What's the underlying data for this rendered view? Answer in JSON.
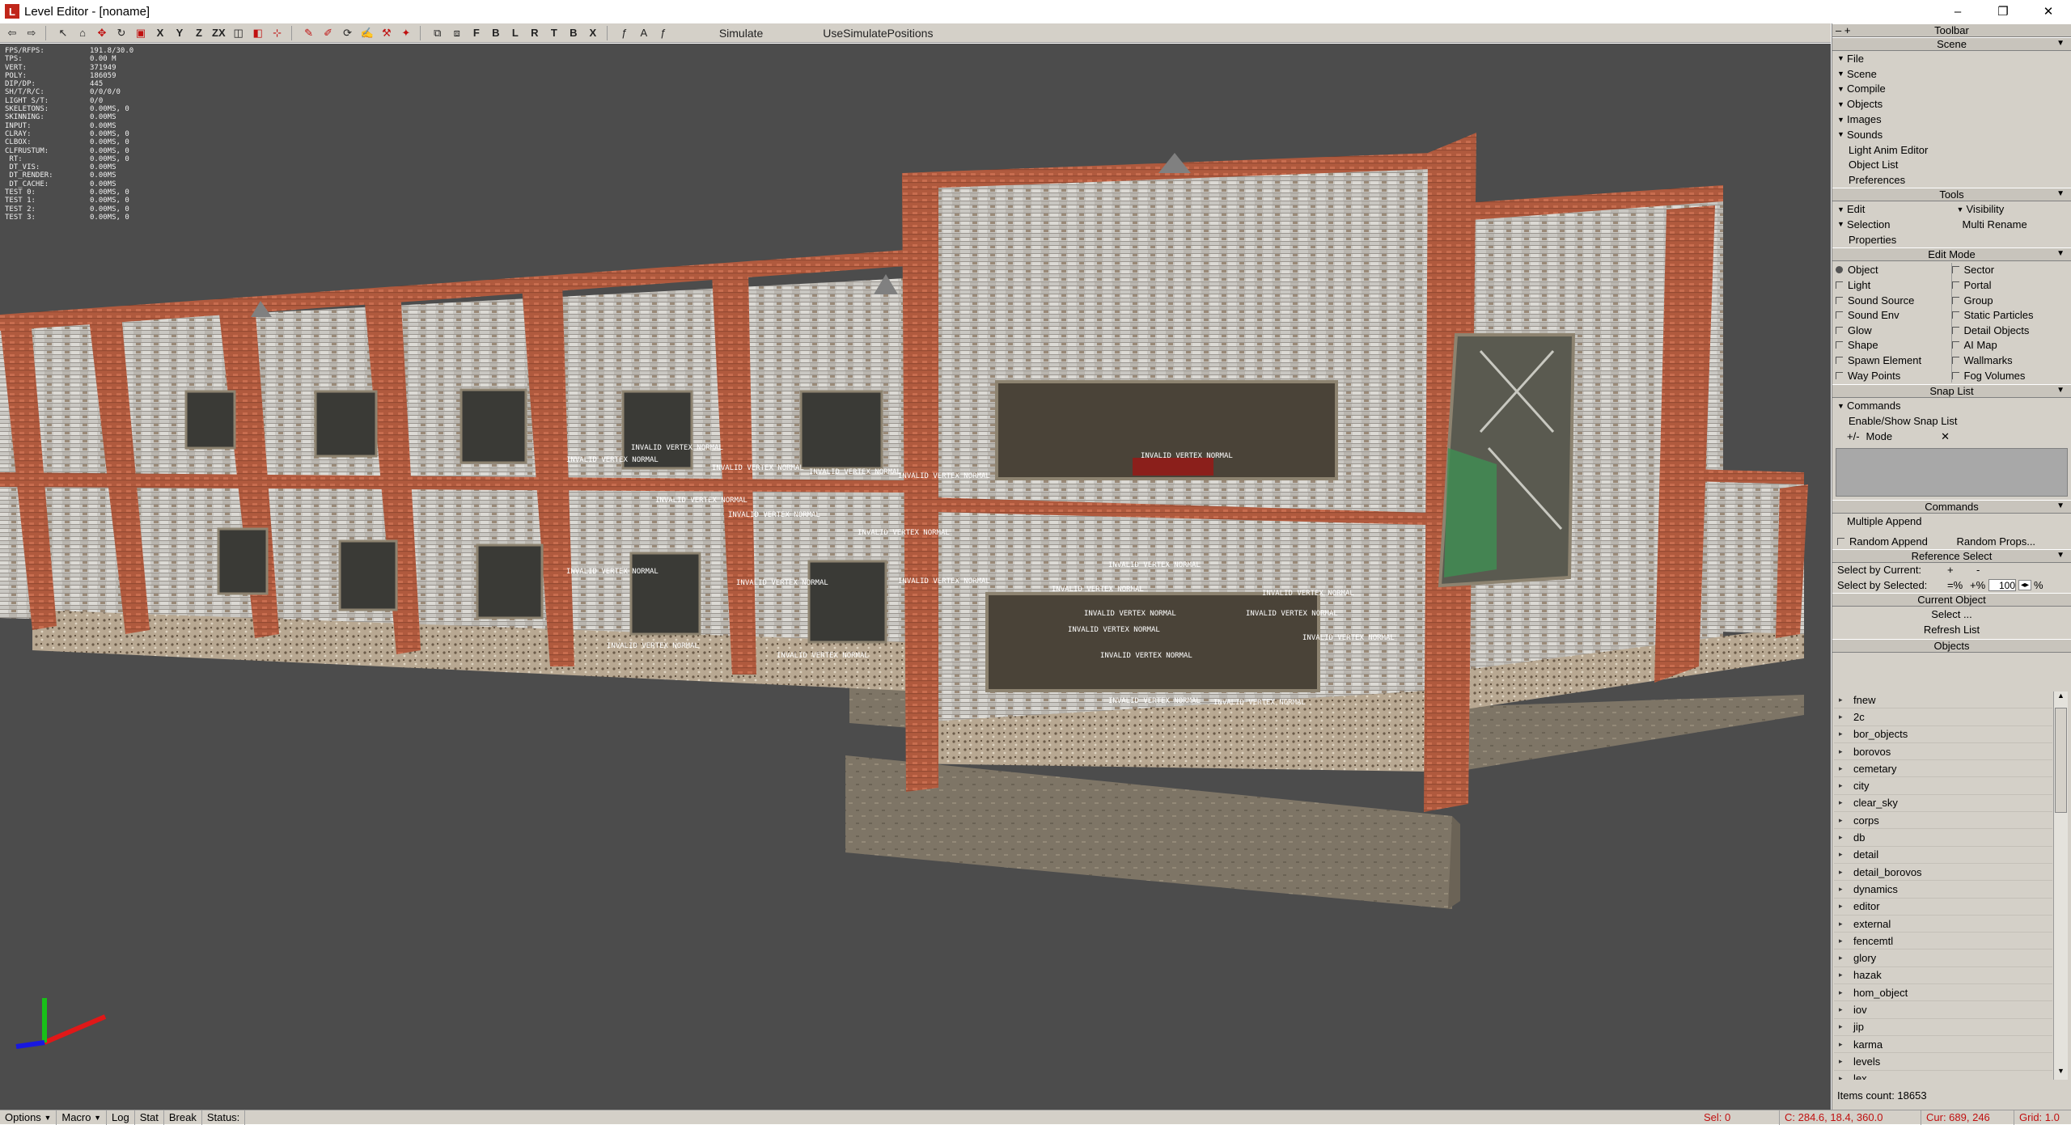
{
  "window": {
    "title": "Level Editor - [noname]",
    "app_icon": "level-editor-logo",
    "controls": [
      "–",
      "❐",
      "✕"
    ]
  },
  "toolbar": {
    "axis_buttons": [
      "X",
      "Y",
      "Z",
      "ZX"
    ],
    "view_buttons": [
      "F",
      "B",
      "L",
      "R",
      "T",
      "B",
      "X"
    ],
    "simulate": "Simulate",
    "use_simulate_positions": "UseSimulatePositions"
  },
  "stats": [
    [
      "FPS/RFPS:",
      "191.8/30.0"
    ],
    [
      "TPS:",
      "0.00 M"
    ],
    [
      "VERT:",
      "371949"
    ],
    [
      "POLY:",
      "186059"
    ],
    [
      "DIP/DP:",
      "445"
    ],
    [
      "SH/T/R/C:",
      "0/0/0/0"
    ],
    [
      "LIGHT S/T:",
      "0/0"
    ],
    [
      "SKELETONS:",
      "0.00MS, 0"
    ],
    [
      "SKINNING:",
      "0.00MS"
    ],
    [
      "",
      ""
    ],
    [
      "INPUT:",
      "0.00MS"
    ],
    [
      "CLRAY:",
      "0.00MS, 0"
    ],
    [
      "CLBOX:",
      "0.00MS, 0"
    ],
    [
      "CLFRUSTUM:",
      "0.00MS, 0"
    ],
    [
      "",
      ""
    ],
    [
      " RT:",
      "0.00MS, 0"
    ],
    [
      " DT_VIS:",
      "0.00MS"
    ],
    [
      " DT_RENDER:",
      "0.00MS"
    ],
    [
      " DT_CACHE:",
      "0.00MS"
    ],
    [
      "",
      ""
    ],
    [
      "TEST 0:",
      "0.00MS, 0"
    ],
    [
      "TEST 1:",
      "0.00MS, 0"
    ],
    [
      "TEST 2:",
      "0.00MS, 0"
    ],
    [
      "TEST 3:",
      "0.00MS, 0"
    ]
  ],
  "invalid_label": "INVALID VERTEX NORMAL",
  "panel": {
    "toolbar_header": "Toolbar",
    "scene_header": "Scene",
    "scene_items": [
      "File",
      "Scene",
      "Compile",
      "Objects",
      "Images",
      "Sounds"
    ],
    "scene_plain": [
      "Light Anim Editor",
      "Object List",
      "Preferences"
    ],
    "tools_header": "Tools",
    "tools": {
      "edit": "Edit",
      "visibility": "Visibility",
      "selection": "Selection",
      "multi_rename": "Multi Rename",
      "properties": "Properties"
    },
    "edit_mode_header": "Edit Mode",
    "edit_mode_left": [
      "Object",
      "Light",
      "Sound Source",
      "Sound Env",
      "Glow",
      "Shape",
      "Spawn Element",
      "Way Points"
    ],
    "edit_mode_right": [
      "Sector",
      "Portal",
      "Group",
      "Static Particles",
      "Detail Objects",
      "AI Map",
      "Wallmarks",
      "Fog Volumes"
    ],
    "snap_list_header": "Snap List",
    "snap_commands": "Commands",
    "snap_enable": "Enable/Show Snap List",
    "snap_mode_prefix": "+/-",
    "snap_mode": "Mode",
    "snap_mode_close": "✕",
    "commands_header": "Commands",
    "multiple_append": "Multiple Append",
    "random_append": "Random Append",
    "random_props": "Random Props...",
    "reference_header": "Reference Select",
    "select_by_current": "Select by Current:",
    "select_by_selected": "Select by Selected:",
    "plus": "+",
    "minus": "-",
    "eq_pct": "=%",
    "plus_pct": "+%",
    "pct_value": "100",
    "pct": "%",
    "current_object_header": "Current Object",
    "select_btn": "Select ...",
    "refresh_btn": "Refresh List",
    "objects_header": "Objects",
    "objects": [
      "fnew",
      "2c",
      "bor_objects",
      "borovos",
      "cemetary",
      "city",
      "clear_sky",
      "corps",
      "db",
      "detail",
      "detail_borovos",
      "dynamics",
      "editor",
      "external",
      "fencemtl",
      "glory",
      "hazak",
      "hom_object",
      "iov",
      "jip",
      "karma",
      "levels",
      "lex"
    ],
    "items_count": "Items count: 18653"
  },
  "statusbar": {
    "options": "Options",
    "macro": "Macro",
    "log": "Log",
    "stat": "Stat",
    "break": "Break",
    "status": "Status:",
    "sel": "Sel: 0",
    "coords": "C: 284.6, 18.4, 360.0",
    "cur": "Cur: 689, 246",
    "grid": "Grid: 1.0"
  },
  "colors": {
    "viewport_bg": "#4c4c4c",
    "brick": "#b05a3e",
    "panel_bg": "#d4d0c8",
    "accent_red": "#c01010"
  }
}
